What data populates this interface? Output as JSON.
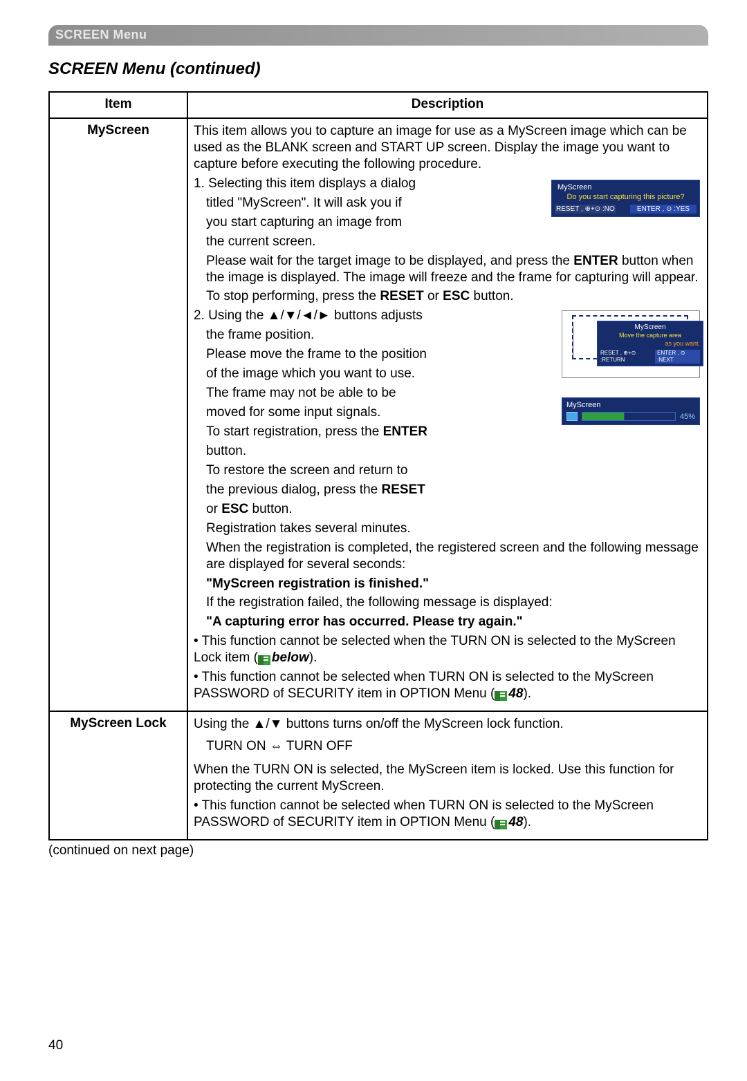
{
  "top_bar": "SCREEN Menu",
  "section_title": "SCREEN Menu (continued)",
  "table": {
    "header_item": "Item",
    "header_desc": "Description"
  },
  "row1": {
    "item": "MyScreen",
    "p1": "This item allows you to capture an image for use as a MyScreen image which can be used as the BLANK screen and START UP screen. Display the image you want to capture before executing the following procedure.",
    "s1a": "1. Selecting this item displays a dialog",
    "s1b": "titled \"MyScreen\". It will ask you if",
    "s1c": "you start capturing an image from",
    "s1d": "the current screen.",
    "s1e": "Please wait for the target image to be displayed, and press the ",
    "s1e_bold": "ENTER",
    "s1e2": " button when the image is displayed. The image will freeze and the frame for capturing will appear.",
    "s1f": "To stop performing, press the ",
    "s1f_reset": "RESET",
    "s1f_or": " or ",
    "s1f_esc": "ESC",
    "s1f_end": " button.",
    "s2a": "2. Using the ▲/▼/◄/► buttons adjusts",
    "s2b": "the frame position.",
    "s2c": "Please move the frame to the position",
    "s2d": "of the image which you want to use.",
    "s2e": "The frame may not be able to be",
    "s2f": "moved for some input signals.",
    "s2g1": "To start registration, press the ",
    "s2g_enter": "ENTER",
    "s2h": "button.",
    "s2i": "To restore the screen and return to",
    "s2j1": "the previous dialog, press the ",
    "s2j_reset": "RESET",
    "s2k1": "or ",
    "s2k_esc": "ESC",
    "s2k2": " button.",
    "s2l": "Registration takes several minutes.",
    "s3a": "When the registration is completed, the registered screen and the following message are displayed for several seconds:",
    "s3b": "\"MyScreen registration is finished.\"",
    "s3c": "If the registration failed, the following message is displayed:",
    "s3d": "\"A capturing error has occurred. Please try again.\"",
    "b1a": "• This function cannot be selected when the TURN ON is selected to the MyScreen Lock item (",
    "b1_below": "below",
    "b1_end": ").",
    "b2a": "• This function cannot be selected when TURN ON is selected to the MyScreen PASSWORD of SECURITY item in OPTION Menu (",
    "b2_page": "48",
    "b2_end": ").",
    "osd1": {
      "title": "MyScreen",
      "question": "Do you start capturing this picture?",
      "left": "RESET , ⊕+⊙ :NO",
      "right": "ENTER , ⊙ :YES"
    },
    "osd2": {
      "title": "MyScreen",
      "line1": "Move the capture area",
      "line2": "as you want.",
      "left": "RESET , ⊕+⊙ :RETURN",
      "right": "ENTER , ⊙ :NEXT"
    },
    "osd3": {
      "title": "MyScreen",
      "pct": "45%"
    }
  },
  "row2": {
    "item": "MyScreen Lock",
    "p1": "Using the ▲/▼ buttons turns on/off the MyScreen lock function.",
    "toggle": "TURN ON ⇔ TURN OFF",
    "p2": "When the TURN ON is selected, the MyScreen item is locked. Use this function for protecting the current MyScreen.",
    "b1a": "• This function cannot be selected when TURN ON is selected to the MyScreen PASSWORD of SECURITY item in OPTION Menu (",
    "b1_page": "48",
    "b1_end": ")."
  },
  "continued": "(continued on next page)",
  "page_number": "40"
}
